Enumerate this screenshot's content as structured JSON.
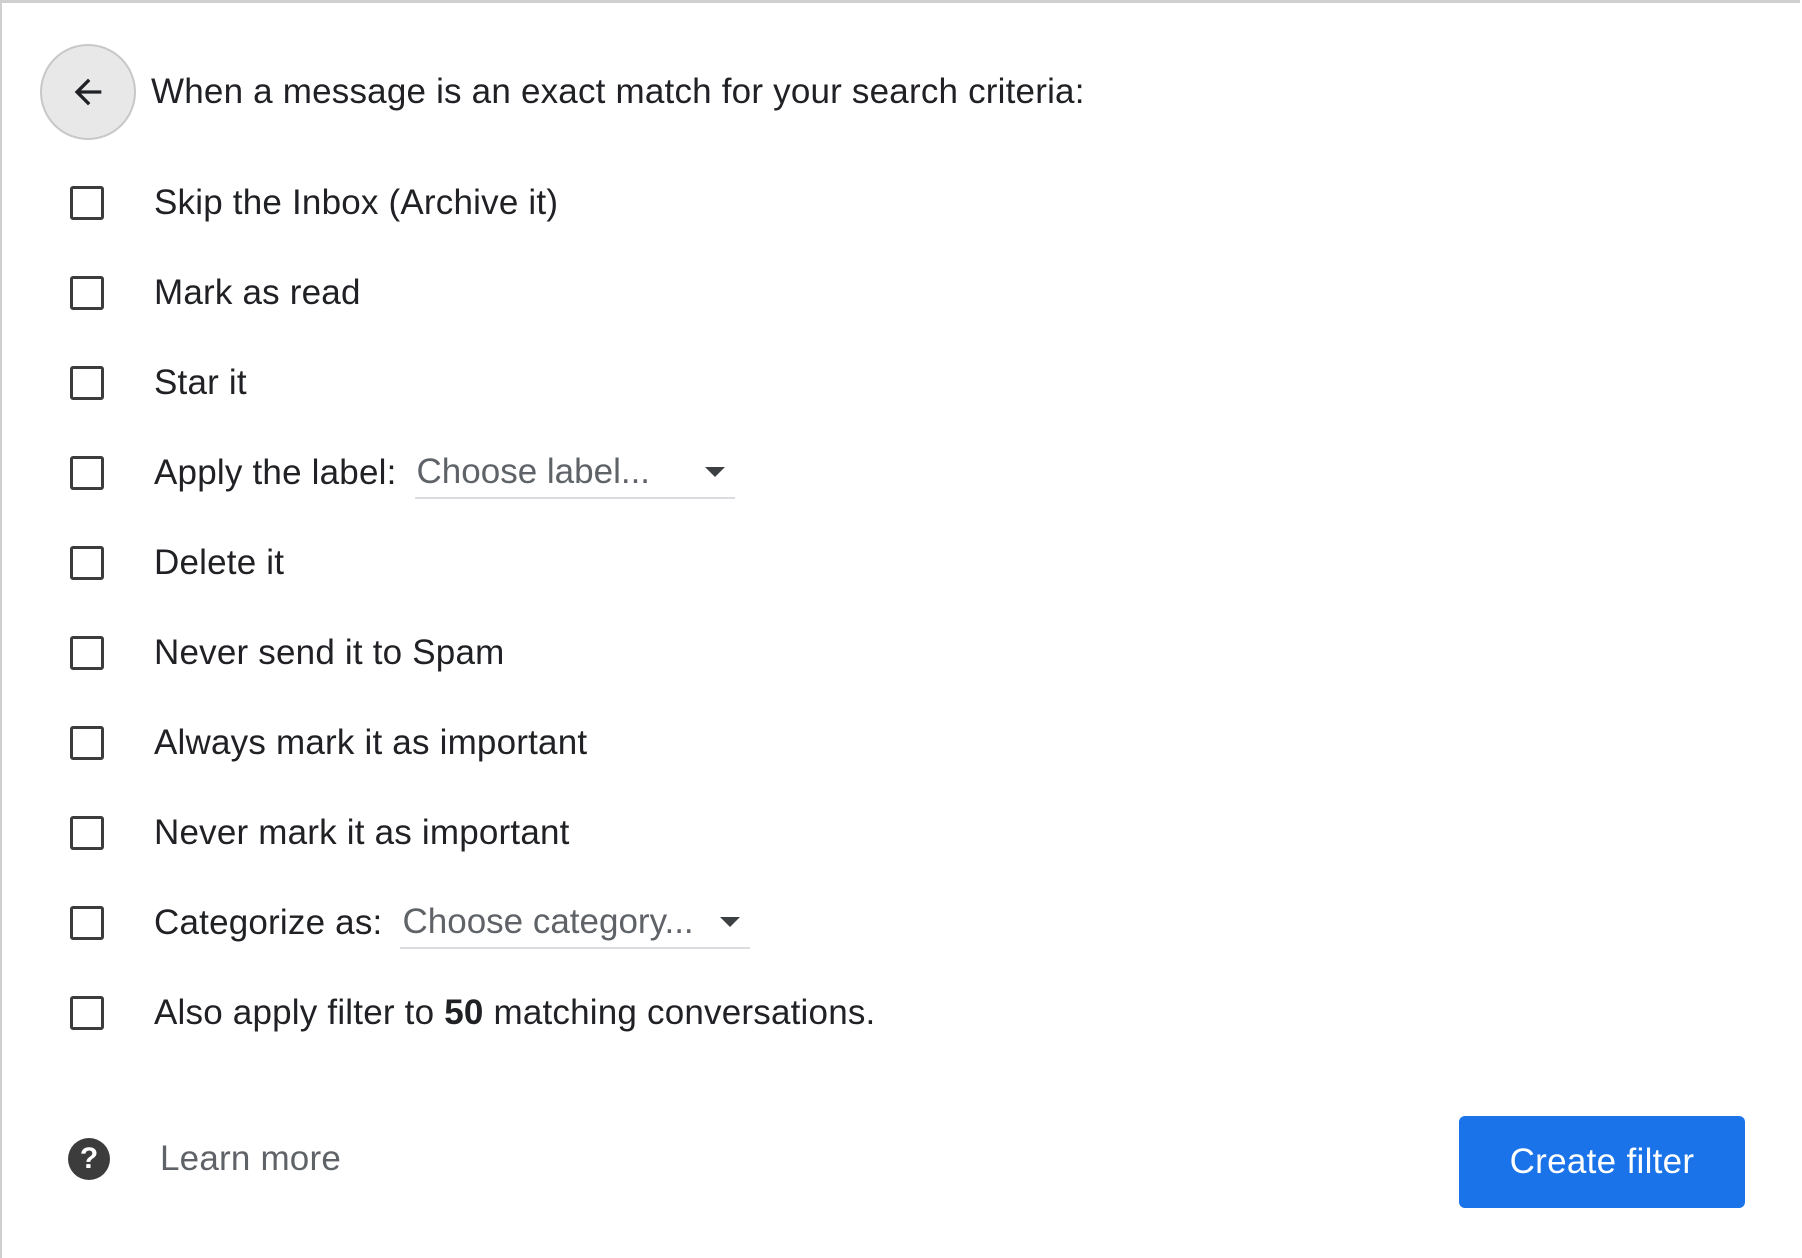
{
  "header": {
    "back_icon": "arrow-left-icon",
    "text": "When a message is an exact match for your search criteria:"
  },
  "options": [
    {
      "label": "Skip the Inbox (Archive it)",
      "checked": false
    },
    {
      "label": "Mark as read",
      "checked": false
    },
    {
      "label": "Star it",
      "checked": false
    },
    {
      "label": "Apply the label:",
      "checked": false,
      "select_value": "Choose label..."
    },
    {
      "label": "Delete it",
      "checked": false
    },
    {
      "label": "Never send it to Spam",
      "checked": false
    },
    {
      "label": "Always mark it as important",
      "checked": false
    },
    {
      "label": "Never mark it as important",
      "checked": false
    },
    {
      "label": "Categorize as:",
      "checked": false,
      "select_value": "Choose category..."
    },
    {
      "label_prefix": "Also apply filter to",
      "count": "50",
      "label_suffix": "matching conversations.",
      "checked": false
    }
  ],
  "footer": {
    "help_icon": "question-circle-icon",
    "help_symbol": "?",
    "learn_more": "Learn more",
    "create_filter": "Create filter"
  },
  "colors": {
    "primary_button": "#1a73e8",
    "text": "#202124",
    "secondary_text": "#5f6368"
  }
}
